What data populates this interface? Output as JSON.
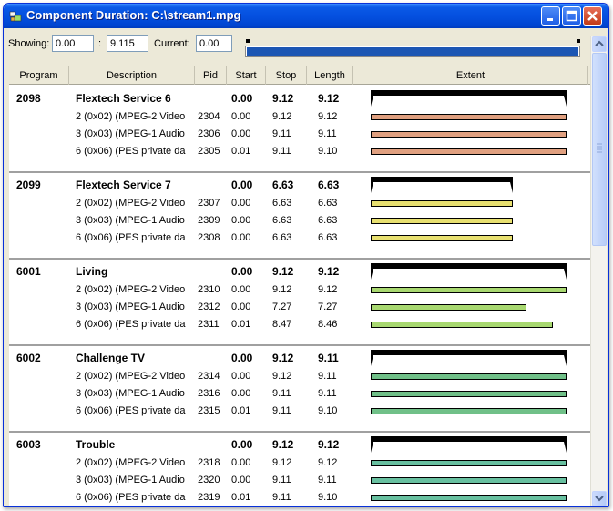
{
  "window": {
    "title": "Component Duration: C:\\stream1.mpg",
    "minimize_label": "_",
    "maximize_label": "□",
    "close_label": "×"
  },
  "toolbar": {
    "showing_label": "Showing:",
    "start_value": "0.00",
    "separator": ":",
    "end_value": "9.115",
    "current_label": "Current:",
    "current_value": "0.00"
  },
  "columns": [
    "Program",
    "Description",
    "Pid",
    "Start",
    "Stop",
    "Length",
    "Extent"
  ],
  "groups": [
    {
      "program": "2098",
      "name": "Flextech Service 6",
      "start": "0.00",
      "stop": "9.12",
      "length": "9.12",
      "extent_fraction": 1.0,
      "bar_color": "#e0a080",
      "components": [
        {
          "description": "2 (0x02) (MPEG-2 Video",
          "pid": "2304",
          "start": "0.00",
          "stop": "9.12",
          "length": "9.12",
          "extent_fraction": 1.0
        },
        {
          "description": "3 (0x03) (MPEG-1 Audio",
          "pid": "2306",
          "start": "0.00",
          "stop": "9.11",
          "length": "9.11",
          "extent_fraction": 1.0
        },
        {
          "description": "6 (0x06) (PES private da",
          "pid": "2305",
          "start": "0.01",
          "stop": "9.11",
          "length": "9.10",
          "extent_fraction": 1.0
        }
      ]
    },
    {
      "program": "2099",
      "name": "Flextech Service 7",
      "start": "0.00",
      "stop": "6.63",
      "length": "6.63",
      "extent_fraction": 0.727,
      "bar_color": "#e8e070",
      "components": [
        {
          "description": "2 (0x02) (MPEG-2 Video",
          "pid": "2307",
          "start": "0.00",
          "stop": "6.63",
          "length": "6.63",
          "extent_fraction": 0.727
        },
        {
          "description": "3 (0x03) (MPEG-1 Audio",
          "pid": "2309",
          "start": "0.00",
          "stop": "6.63",
          "length": "6.63",
          "extent_fraction": 0.727
        },
        {
          "description": "6 (0x06) (PES private da",
          "pid": "2308",
          "start": "0.00",
          "stop": "6.63",
          "length": "6.63",
          "extent_fraction": 0.727
        }
      ]
    },
    {
      "program": "6001",
      "name": "Living",
      "start": "0.00",
      "stop": "9.12",
      "length": "9.12",
      "extent_fraction": 1.0,
      "bar_color": "#a8d870",
      "components": [
        {
          "description": "2 (0x02) (MPEG-2 Video",
          "pid": "2310",
          "start": "0.00",
          "stop": "9.12",
          "length": "9.12",
          "extent_fraction": 1.0
        },
        {
          "description": "3 (0x03) (MPEG-1 Audio",
          "pid": "2312",
          "start": "0.00",
          "stop": "7.27",
          "length": "7.27",
          "extent_fraction": 0.797
        },
        {
          "description": "6 (0x06) (PES private da",
          "pid": "2311",
          "start": "0.01",
          "stop": "8.47",
          "length": "8.46",
          "extent_fraction": 0.929
        }
      ]
    },
    {
      "program": "6002",
      "name": "Challenge TV",
      "start": "0.00",
      "stop": "9.12",
      "length": "9.11",
      "extent_fraction": 1.0,
      "bar_color": "#70c088",
      "components": [
        {
          "description": "2 (0x02) (MPEG-2 Video",
          "pid": "2314",
          "start": "0.00",
          "stop": "9.12",
          "length": "9.11",
          "extent_fraction": 1.0
        },
        {
          "description": "3 (0x03) (MPEG-1 Audio",
          "pid": "2316",
          "start": "0.00",
          "stop": "9.11",
          "length": "9.11",
          "extent_fraction": 1.0
        },
        {
          "description": "6 (0x06) (PES private da",
          "pid": "2315",
          "start": "0.01",
          "stop": "9.11",
          "length": "9.10",
          "extent_fraction": 1.0
        }
      ]
    },
    {
      "program": "6003",
      "name": "Trouble",
      "start": "0.00",
      "stop": "9.12",
      "length": "9.12",
      "extent_fraction": 1.0,
      "bar_color": "#68c0a0",
      "components": [
        {
          "description": "2 (0x02) (MPEG-2 Video",
          "pid": "2318",
          "start": "0.00",
          "stop": "9.12",
          "length": "9.12",
          "extent_fraction": 1.0
        },
        {
          "description": "3 (0x03) (MPEG-1 Audio",
          "pid": "2320",
          "start": "0.00",
          "stop": "9.11",
          "length": "9.11",
          "extent_fraction": 1.0
        },
        {
          "description": "6 (0x06) (PES private da",
          "pid": "2319",
          "start": "0.01",
          "stop": "9.11",
          "length": "9.10",
          "extent_fraction": 1.0
        }
      ]
    }
  ],
  "range_slider": {
    "showing_fraction": 1.0
  },
  "colors": {
    "titlebar": "#0550e0",
    "slider_fill": "#1c56b3"
  }
}
